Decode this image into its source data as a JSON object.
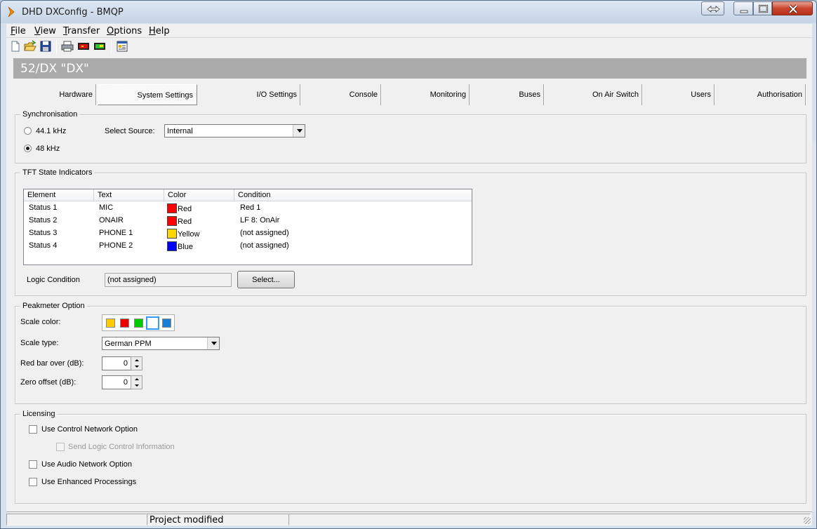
{
  "window": {
    "title": "DHD DXConfig - BMQP"
  },
  "menu": [
    {
      "key": "F",
      "rest": "ile"
    },
    {
      "key": "V",
      "rest": "iew"
    },
    {
      "key": "T",
      "rest": "ransfer"
    },
    {
      "key": "O",
      "rest": "ptions"
    },
    {
      "key": "H",
      "rest": "elp"
    }
  ],
  "toolbar_icons": [
    "new-file-icon",
    "open-folder-icon",
    "save-icon",
    "print-icon",
    "device-red-icon",
    "device-green-icon",
    "properties-icon"
  ],
  "header": {
    "device_title": "52/DX \"DX\""
  },
  "tabs": [
    "Hardware",
    "System Settings",
    "I/O Settings",
    "Console",
    "Monitoring",
    "Buses",
    "On Air Switch",
    "Users",
    "Authorisation"
  ],
  "active_tab": "System Settings",
  "sync": {
    "title": "Synchronisation",
    "option_441": "44.1 kHz",
    "option_48": "48 kHz",
    "selected": "48 kHz",
    "source_label": "Select Source:",
    "source_value": "Internal"
  },
  "tft": {
    "title": "TFT State Indicators",
    "columns": [
      "Element",
      "Text",
      "Color",
      "Condition"
    ],
    "rows": [
      {
        "element": "Status 1",
        "text": "MIC",
        "color_name": "Red",
        "color_hex": "#ff0000",
        "condition": "Red 1"
      },
      {
        "element": "Status 2",
        "text": "ONAIR",
        "color_name": "Red",
        "color_hex": "#ff0000",
        "condition": "LF 8: OnAir"
      },
      {
        "element": "Status 3",
        "text": "PHONE 1",
        "color_name": "Yellow",
        "color_hex": "#ffd700",
        "condition": "(not assigned)"
      },
      {
        "element": "Status 4",
        "text": "PHONE 2",
        "color_name": "Blue",
        "color_hex": "#0000ff",
        "condition": "(not assigned)"
      }
    ],
    "logic_label": "Logic Condition",
    "logic_value": "(not assigned)",
    "select_button": "Select..."
  },
  "peak": {
    "title": "Peakmeter Option",
    "scale_color_label": "Scale color:",
    "scale_colors": [
      "#ffcc00",
      "#ee0000",
      "#00cc00",
      "#ffffff",
      "#1a7fd4"
    ],
    "scale_color_selected_index": 3,
    "scale_type_label": "Scale type:",
    "scale_type_value": "German PPM",
    "red_bar_label": "Red bar over (dB):",
    "red_bar_value": "0",
    "zero_offset_label": "Zero offset (dB):",
    "zero_offset_value": "0"
  },
  "licensing": {
    "title": "Licensing",
    "control_network": "Use Control Network Option",
    "send_logic": "Send Logic Control Information",
    "audio_network": "Use Audio Network Option",
    "enhanced": "Use Enhanced Processings"
  },
  "status": {
    "left": "",
    "message": "Project modified"
  },
  "colors": {
    "header_band": "#aaaaaa",
    "window_frame": "#d7e1ec",
    "close_button": "#c9442c"
  }
}
